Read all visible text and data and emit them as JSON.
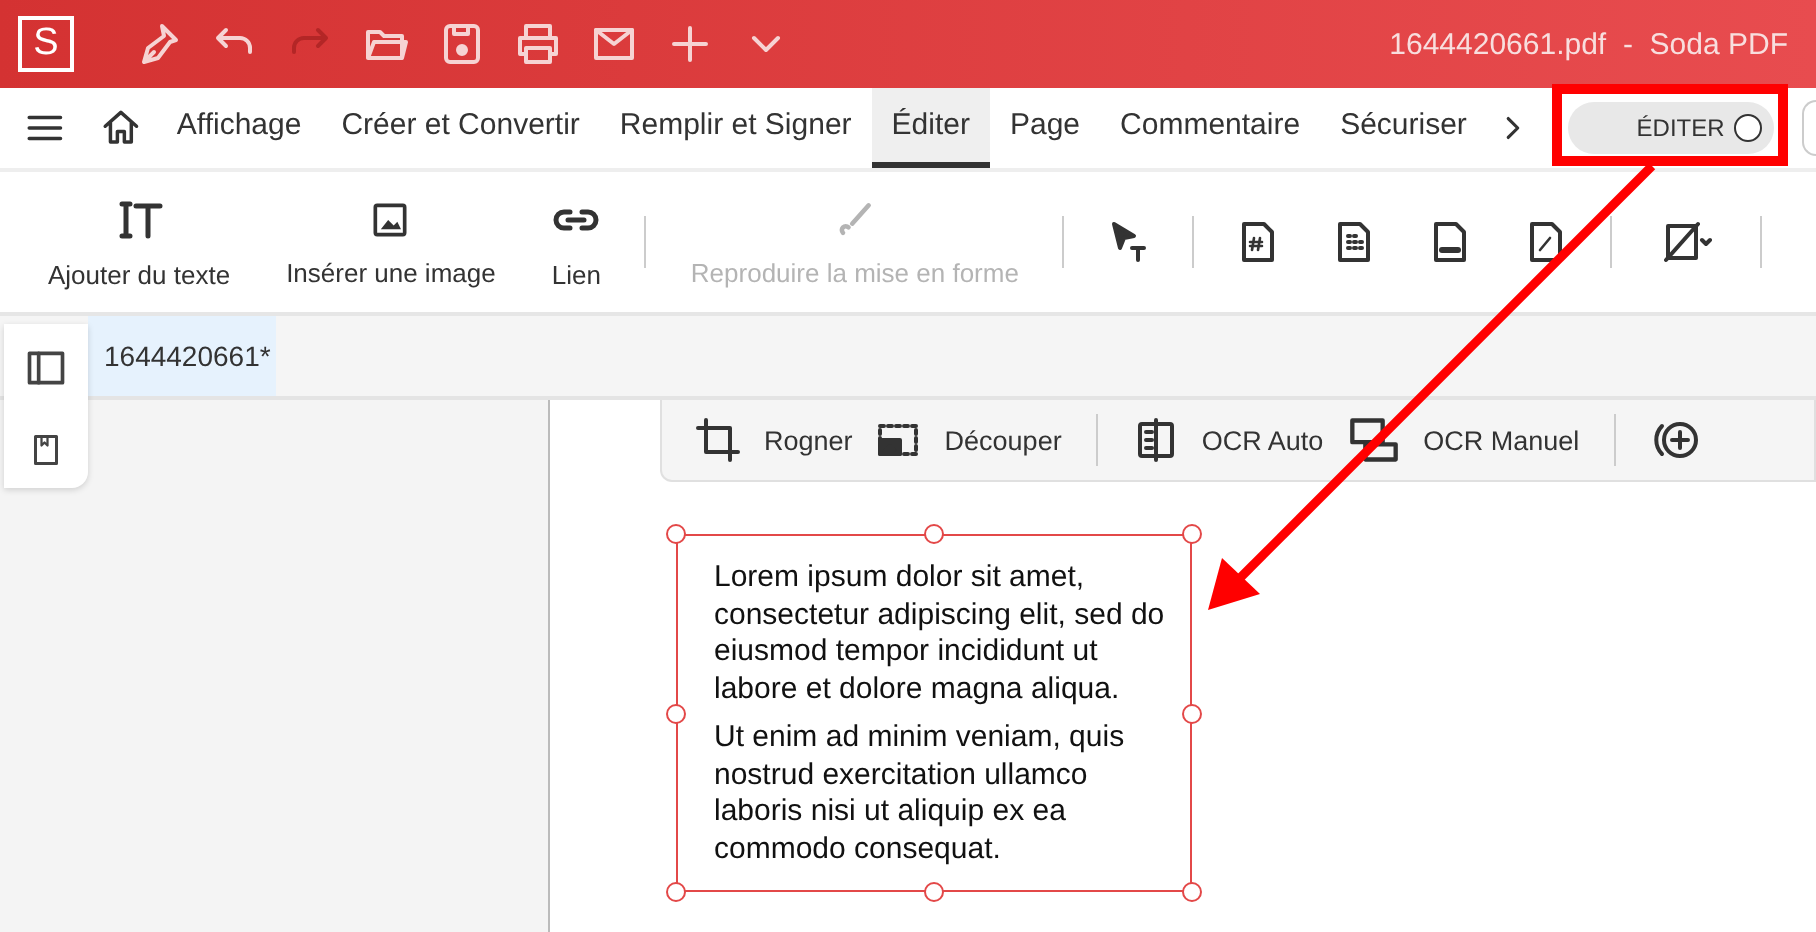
{
  "title_bar": {
    "logo": "S",
    "file": "1644420661.pdf",
    "separator": "-",
    "app": "Soda PDF"
  },
  "menu_tabs": [
    {
      "label": "Affichage",
      "selected": false
    },
    {
      "label": "Créer et Convertir",
      "selected": false
    },
    {
      "label": "Remplir et Signer",
      "selected": false
    },
    {
      "label": "Éditer",
      "selected": true
    },
    {
      "label": "Page",
      "selected": false
    },
    {
      "label": "Commentaire",
      "selected": false
    },
    {
      "label": "Sécuriser",
      "selected": false
    }
  ],
  "mode_toggle": {
    "label": "ÉDITER",
    "on": false
  },
  "toolbar": [
    {
      "label": "Ajouter du texte",
      "kind": "text",
      "disabled": false
    },
    {
      "label": "Insérer une image",
      "kind": "image",
      "disabled": false
    },
    {
      "label": "Lien",
      "kind": "link",
      "disabled": false
    },
    {
      "label": "Reproduire la mise en forme",
      "kind": "brush",
      "disabled": true
    }
  ],
  "document_tab": {
    "label": "1644420661*",
    "selected": true
  },
  "edit_toolbar": [
    {
      "label": "Rogner",
      "kind": "crop"
    },
    {
      "label": "Découper",
      "kind": "cut"
    },
    {
      "label": "OCR Auto",
      "kind": "ocr"
    },
    {
      "label": "OCR Manuel",
      "kind": "area"
    }
  ],
  "text_box": {
    "paragraphs": [
      "Lorem ipsum dolor sit amet, consectetur adipiscing elit, sed do eiusmod tempor incididunt ut labore et dolore magna aliqua.",
      "Ut enim ad minim veniam, quis nostrud exercitation ullamco laboris nisi ut aliquip ex ea commodo consequat."
    ]
  }
}
